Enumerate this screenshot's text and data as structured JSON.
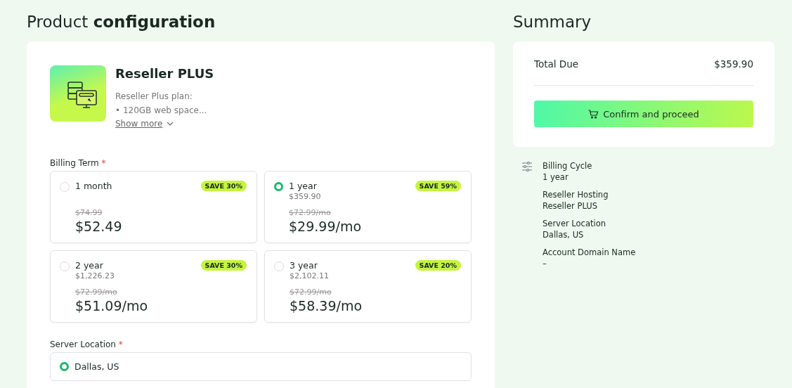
{
  "heading": "Product **configuration**",
  "product": {
    "name": "Reseller PLUS",
    "description": [
      "Reseller Plus plan:",
      "• 120GB web space..."
    ],
    "show_more": "Show more"
  },
  "billing_term": {
    "label": "Billing Term",
    "required_mark": "*",
    "options": [
      {
        "term": "1 month",
        "badge": "SAVE 30%",
        "old_price": "$74.99",
        "price": "$52.49",
        "selected": false
      },
      {
        "term": "1 year",
        "total": "$359.90",
        "badge": "SAVE 59%",
        "old_price": "$72.99/mo",
        "price": "$29.99/mo",
        "selected": true
      },
      {
        "term": "2 year",
        "total": "$1,226.23",
        "badge": "SAVE 30%",
        "old_price": "$72.99/mo",
        "price": "$51.09/mo",
        "selected": false
      },
      {
        "term": "3 year",
        "total": "$2,102.11",
        "badge": "SAVE 20%",
        "old_price": "$72.99/mo",
        "price": "$58.39/mo",
        "selected": false
      }
    ]
  },
  "server_location": {
    "label": "Server Location",
    "required_mark": "*",
    "options": [
      {
        "name": "Dallas, US",
        "selected": true
      }
    ]
  },
  "summary": {
    "title": "Summary",
    "total_label": "Total Due",
    "total": "$359.90",
    "button": "Confirm and proceed",
    "details": [
      {
        "label": "Billing Cycle",
        "value": "1 year"
      },
      {
        "label": "Reseller Hosting",
        "value": "Reseller PLUS"
      },
      {
        "label": "Server Location",
        "value": "Dallas, US"
      },
      {
        "label": "Account Domain Name",
        "value": "–"
      }
    ]
  }
}
